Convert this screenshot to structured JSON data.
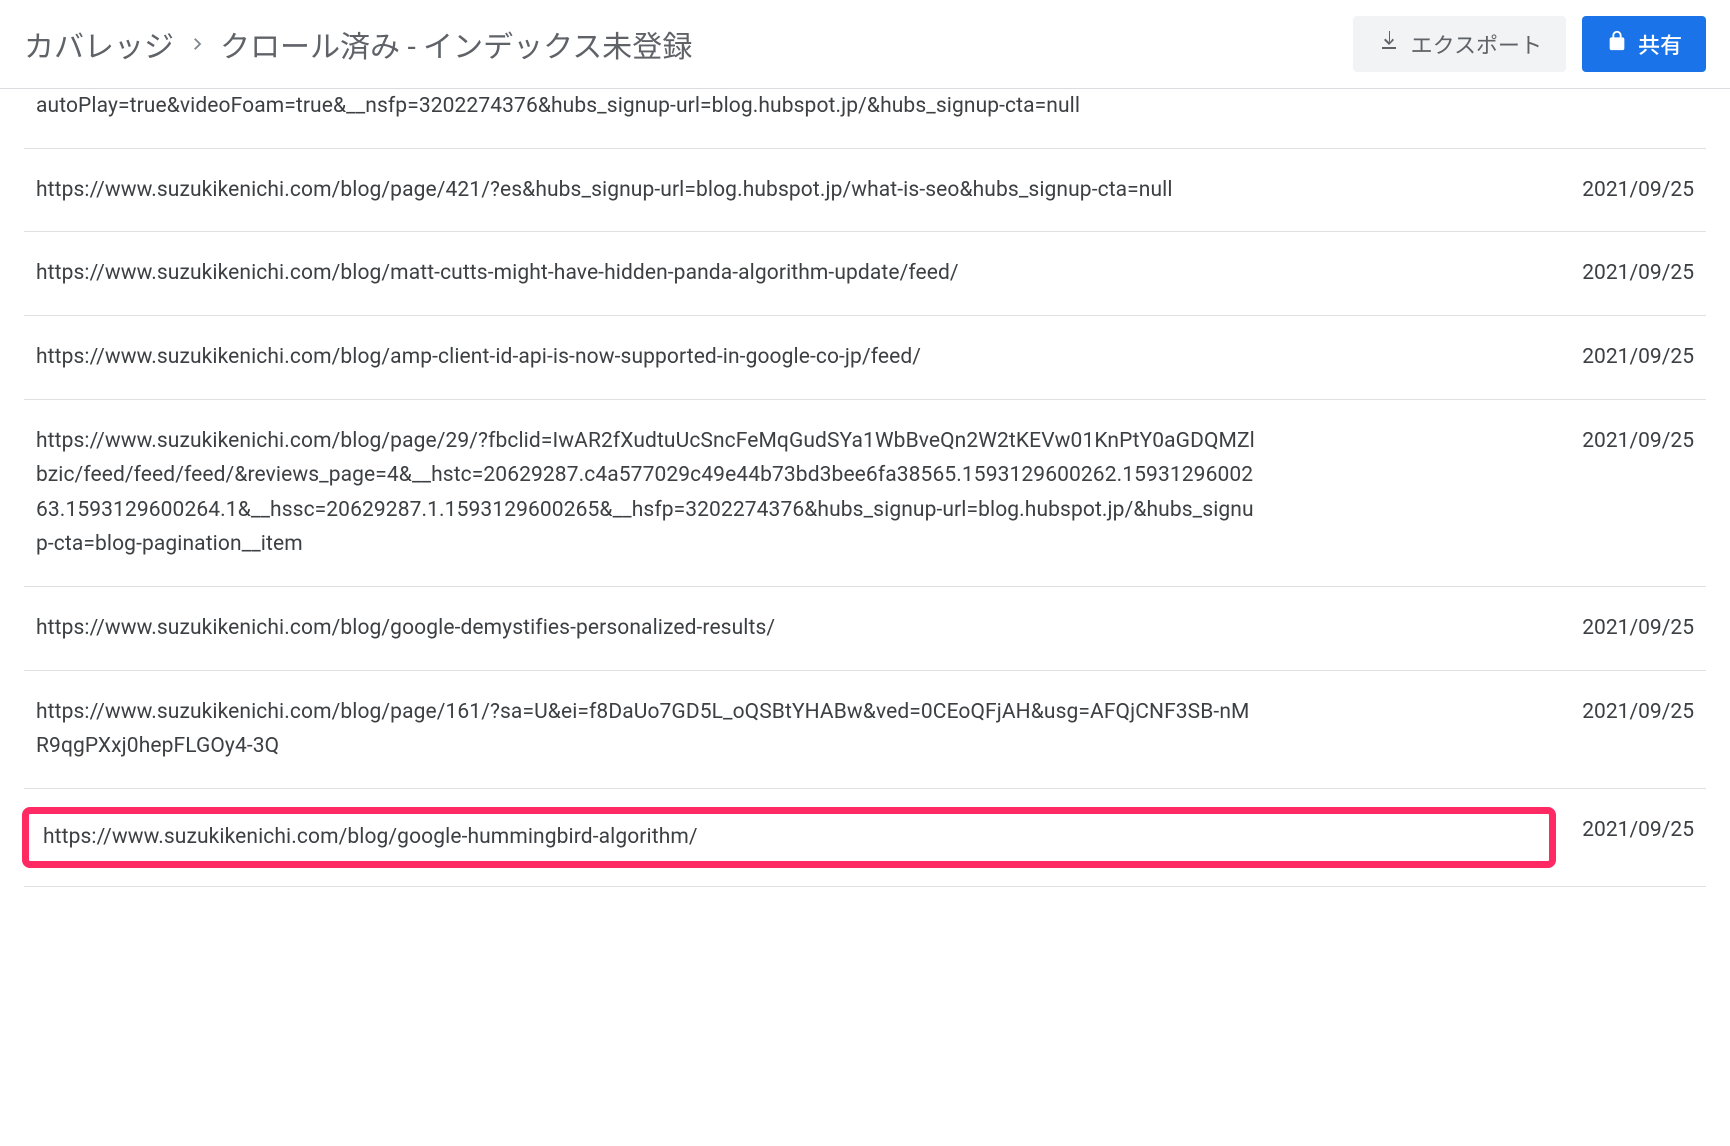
{
  "header": {
    "breadcrumb_root": "カバレッジ",
    "breadcrumb_current": "クロール済み - インデックス未登録",
    "export_label": "エクスポート",
    "share_label": "共有"
  },
  "rows": [
    {
      "url": "autoPlay=true&videoFoam=true&__nsfp=3202274376&hubs_signup-url=blog.hubspot.jp/&hubs_signup-cta=null",
      "date": "",
      "cut": true
    },
    {
      "url": "https://www.suzukikenichi.com/blog/page/421/?es&hubs_signup-url=blog.hubspot.jp/what-is-seo&hubs_signup-cta=null",
      "date": "2021/09/25"
    },
    {
      "url": "https://www.suzukikenichi.com/blog/matt-cutts-might-have-hidden-panda-algorithm-update/feed/",
      "date": "2021/09/25"
    },
    {
      "url": "https://www.suzukikenichi.com/blog/amp-client-id-api-is-now-supported-in-google-co-jp/feed/",
      "date": "2021/09/25"
    },
    {
      "url": "https://www.suzukikenichi.com/blog/page/29/?fbclid=IwAR2fXudtuUcSncFeMqGudSYa1WbBveQn2W2tKEVw01KnPtY0aGDQMZlbzic/feed/feed/feed/&reviews_page=4&__hstc=20629287.c4a577029c49e44b73bd3bee6fa38565.1593129600262.1593129600263.1593129600264.1&__hssc=20629287.1.1593129600265&__hsfp=3202274376&hubs_signup-url=blog.hubspot.jp/&hubs_signup-cta=blog-pagination__item",
      "date": "2021/09/25"
    },
    {
      "url": "https://www.suzukikenichi.com/blog/google-demystifies-personalized-results/",
      "date": "2021/09/25"
    },
    {
      "url": "https://www.suzukikenichi.com/blog/page/161/?sa=U&ei=f8DaUo7GD5L_oQSBtYHABw&ved=0CEoQFjAH&usg=AFQjCNF3SB-nMR9qgPXxj0hepFLGOy4-3Q",
      "date": "2021/09/25"
    },
    {
      "url": "https://www.suzukikenichi.com/blog/google-hummingbird-algorithm/",
      "date": "2021/09/25",
      "highlighted": true
    }
  ]
}
